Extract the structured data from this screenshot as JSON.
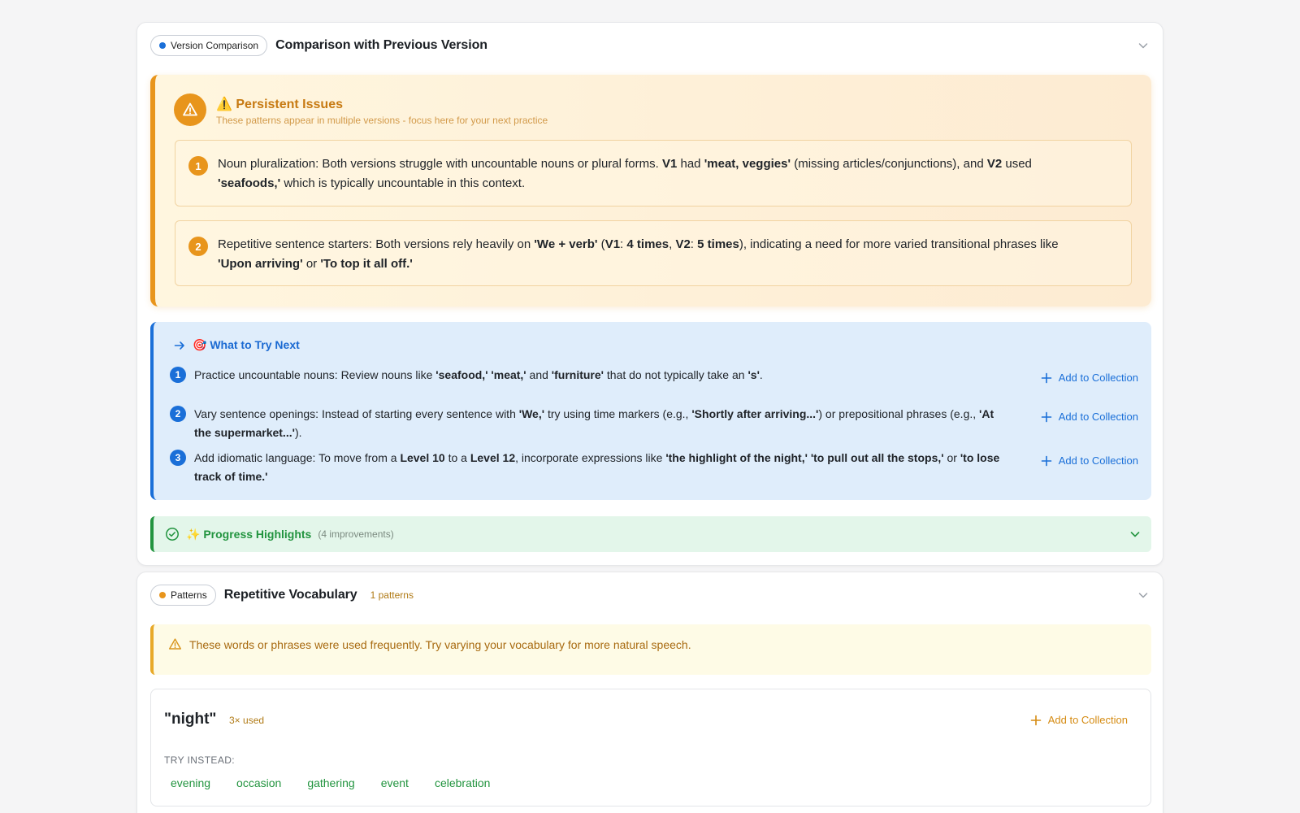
{
  "comparison": {
    "pill_label": "Version Comparison",
    "title": "Comparison with Previous Version",
    "persistent": {
      "title": "⚠️ Persistent Issues",
      "subtitle": "These patterns appear in multiple versions - focus here for your next practice",
      "issues": [
        {
          "num": "1",
          "segments": [
            {
              "t": "Noun pluralization: Both versions struggle with uncountable nouns or plural forms. "
            },
            {
              "t": "V1",
              "b": true
            },
            {
              "t": " had "
            },
            {
              "t": "'meat, veggies'",
              "b": true
            },
            {
              "t": " (missing articles/conjunctions), and "
            },
            {
              "t": "V2",
              "b": true
            },
            {
              "t": " used "
            },
            {
              "t": "'seafoods,'",
              "b": true
            },
            {
              "t": " which is typically uncountable in this context."
            }
          ]
        },
        {
          "num": "2",
          "segments": [
            {
              "t": "Repetitive sentence starters: Both versions rely heavily on "
            },
            {
              "t": "'We + verb'",
              "b": true
            },
            {
              "t": " ("
            },
            {
              "t": "V1",
              "b": true
            },
            {
              "t": ": "
            },
            {
              "t": "4 times",
              "b": true
            },
            {
              "t": ", "
            },
            {
              "t": "V2",
              "b": true
            },
            {
              "t": ": "
            },
            {
              "t": "5 times",
              "b": true
            },
            {
              "t": "), indicating a need for more varied transitional phrases like "
            },
            {
              "t": "'Upon arriving'",
              "b": true
            },
            {
              "t": " or "
            },
            {
              "t": "'To top it all off.'",
              "b": true
            }
          ]
        }
      ]
    },
    "try_next": {
      "title": "🎯 What to Try Next",
      "add_label": "Add to Collection",
      "items": [
        {
          "num": "1",
          "segments": [
            {
              "t": "Practice uncountable nouns: Review nouns like "
            },
            {
              "t": "'seafood,' 'meat,'",
              "b": true
            },
            {
              "t": " and "
            },
            {
              "t": "'furniture'",
              "b": true
            },
            {
              "t": " that do not typically take an "
            },
            {
              "t": "'s'",
              "b": true
            },
            {
              "t": "."
            }
          ]
        },
        {
          "num": "2",
          "segments": [
            {
              "t": "Vary sentence openings: Instead of starting every sentence with "
            },
            {
              "t": "'We,'",
              "b": true
            },
            {
              "t": " try using time markers (e.g., "
            },
            {
              "t": "'Shortly after arriving...'",
              "b": true
            },
            {
              "t": ") or prepositional phrases (e.g., "
            },
            {
              "t": "'At the supermarket...'",
              "b": true
            },
            {
              "t": ")."
            }
          ]
        },
        {
          "num": "3",
          "segments": [
            {
              "t": "Add idiomatic language: To move from a "
            },
            {
              "t": "Level 10",
              "b": true
            },
            {
              "t": " to a "
            },
            {
              "t": "Level 12",
              "b": true
            },
            {
              "t": ", incorporate expressions like "
            },
            {
              "t": "'the highlight of the night,' 'to pull out all the stops,'",
              "b": true
            },
            {
              "t": " or "
            },
            {
              "t": "'to lose track of time.'",
              "b": true
            }
          ]
        }
      ]
    },
    "progress": {
      "title": "✨ Progress Highlights",
      "count": "(4 improvements)"
    }
  },
  "patterns": {
    "pill_label": "Patterns",
    "title": "Repetitive Vocabulary",
    "count": "1 patterns",
    "notice": "These words or phrases were used frequently. Try varying your vocabulary for more natural speech.",
    "word": {
      "text": "\"night\"",
      "used": "3× used",
      "add_label": "Add to Collection",
      "try_instead_label": "TRY INSTEAD:",
      "alternatives": [
        "evening",
        "occasion",
        "gathering",
        "event",
        "celebration"
      ]
    }
  },
  "colors": {
    "version_dot": "#1a6fd8",
    "patterns_dot": "#e8951c",
    "warning": "#e8951c",
    "info": "#1a6fd8",
    "success": "#22943f"
  }
}
